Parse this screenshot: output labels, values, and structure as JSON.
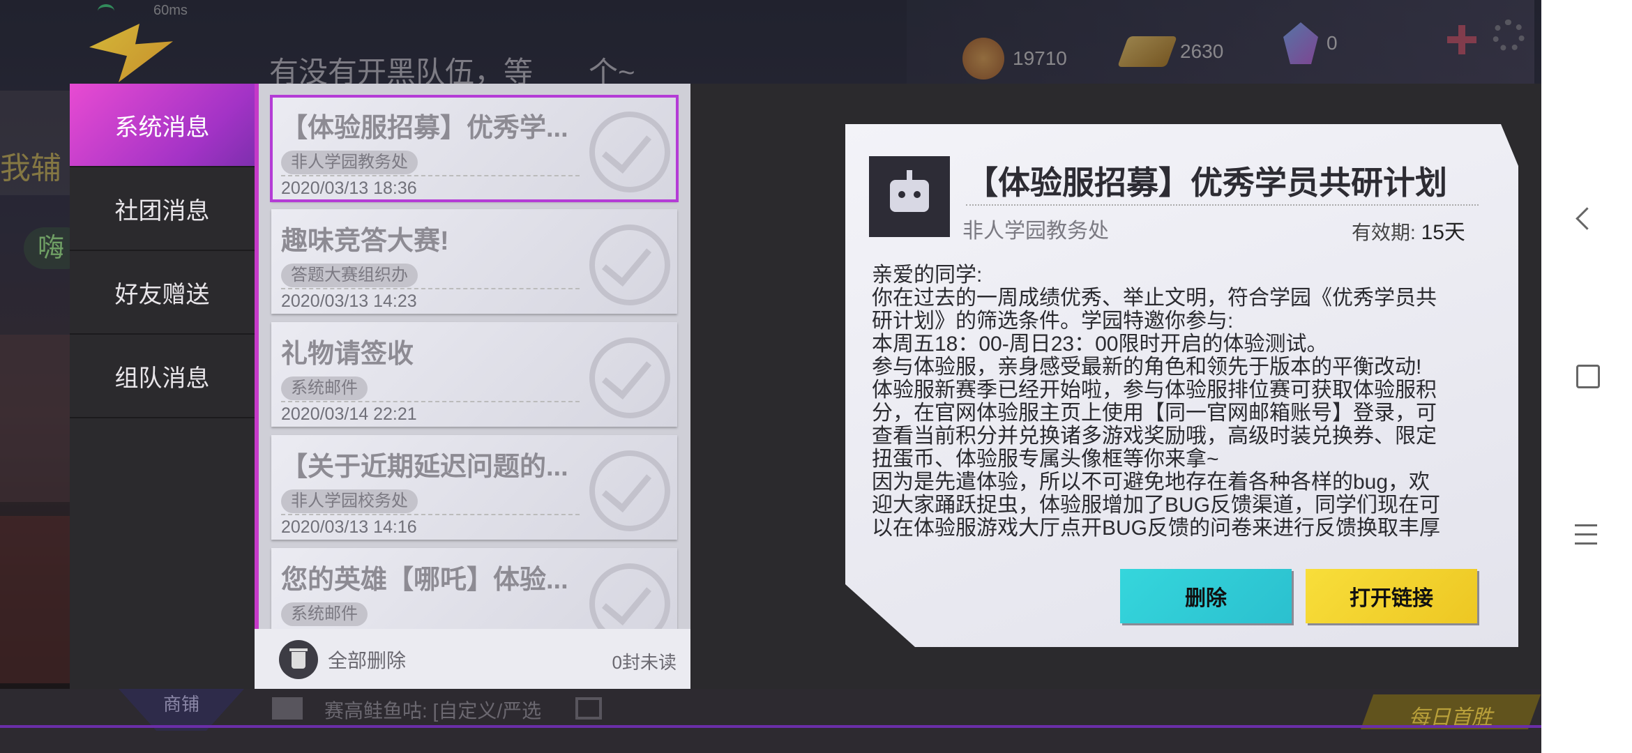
{
  "status": {
    "ping": "60ms"
  },
  "topbar": {
    "chat_preview": "有没有开黑队伍，等",
    "chat_preview_tail": "个~",
    "gold_coins": "19710",
    "gold_bars": "2630",
    "gems": "0"
  },
  "background": {
    "left_text": "我辅",
    "left_badge": "嗨",
    "shop_label": "商铺",
    "chat_line": "赛高鲑鱼咕: [自定义/严选",
    "daily_first_win": "每日首胜"
  },
  "sidebar": {
    "items": [
      {
        "label": "系统消息",
        "active": true
      },
      {
        "label": "社团消息",
        "active": false
      },
      {
        "label": "好友赠送",
        "active": false
      },
      {
        "label": "组队消息",
        "active": false
      }
    ]
  },
  "messages": [
    {
      "title": "【体验服招募】优秀学...",
      "sender": "非人学园教务处",
      "date": "2020/03/13 18:36",
      "selected": true
    },
    {
      "title": "趣味竞答大赛!",
      "sender": "答题大赛组织办",
      "date": "2020/03/13 14:23",
      "selected": false
    },
    {
      "title": "礼物请签收",
      "sender": "系统邮件",
      "date": "2020/03/14 22:21",
      "selected": false
    },
    {
      "title": "【关于近期延迟问题的...",
      "sender": "非人学园校务处",
      "date": "2020/03/13 14:16",
      "selected": false
    },
    {
      "title": "您的英雄【哪吒】体验...",
      "sender": "系统邮件",
      "date": "",
      "selected": false
    }
  ],
  "list_footer": {
    "delete_all": "全部删除",
    "unread": "0封未读"
  },
  "detail": {
    "title": "【体验服招募】优秀学员共研计划",
    "sender": "非人学园教务处",
    "validity_label": "有效期:",
    "validity_value": "15天",
    "body_lines": [
      "亲爱的同学:",
      "你在过去的一周成绩优秀、举止文明，符合学园《优秀学员共",
      "研计划》的筛选条件。学园特邀你参与:",
      "本周五18：00-周日23：00限时开启的体验测试。",
      "参与体验服，亲身感受最新的角色和领先于版本的平衡改动!",
      "体验服新赛季已经开始啦，参与体验服排位赛可获取体验服积",
      "分，在官网体验服主页上使用【同一官网邮箱账号】登录，可",
      "查看当前积分并兑换诸多游戏奖励哦，高级时装兑换券、限定",
      "扭蛋币、体验服专属头像框等你来拿~",
      "因为是先遣体验，所以不可避免地存在着各种各样的bug，欢",
      "迎大家踊跃捉虫，体验服增加了BUG反馈渠道，同学们现在可",
      "以在体验服游戏大厅点开BUG反馈的问卷来进行反馈换取丰厚"
    ],
    "delete_button": "删除",
    "open_link_button": "打开链接",
    "colors": {
      "delete": "#35d6dc",
      "open_link": "#f3d52e"
    }
  },
  "android_nav": {
    "back": "back-icon",
    "home": "home-icon",
    "recents": "menu-icon"
  }
}
